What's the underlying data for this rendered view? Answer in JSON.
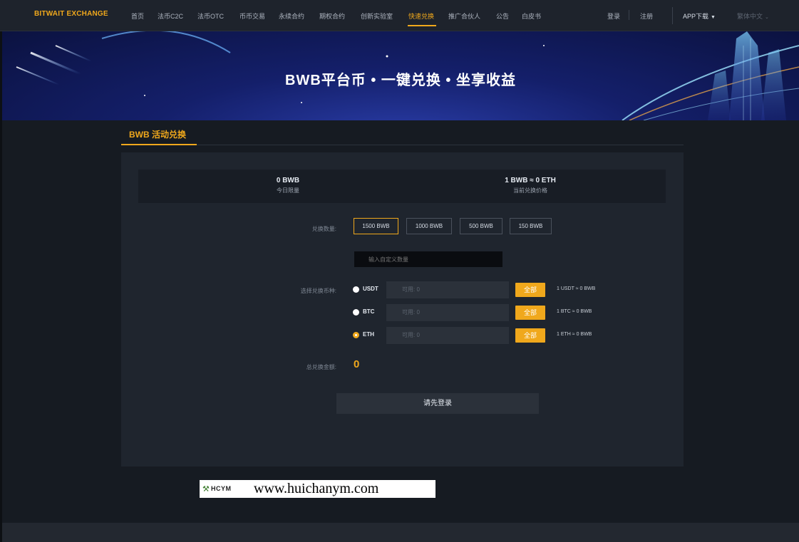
{
  "nav": {
    "logo": "BITWAIT EXCHANGE",
    "items": [
      "首页",
      "法币C2C",
      "法币OTC",
      "币币交易",
      "永续合约",
      "期权合约",
      "创新实验室",
      "快速兑换",
      "推广合伙人",
      "公告",
      "白皮书"
    ],
    "active": "快速兑换",
    "login": "登录",
    "register": "注册",
    "app_download": "APP下载",
    "language": "繁体中文"
  },
  "banner": {
    "title": "BWB平台币 • 一键兑换 • 坐享收益"
  },
  "tab": {
    "label": "BWB 活动兑换"
  },
  "stats": {
    "daily_limit_value": "0 BWB",
    "daily_limit_label": "今日限量",
    "price_value": "1 BWB ≈ 0 ETH",
    "price_label": "当前兑换价格"
  },
  "form": {
    "amount_label": "兑换数量:",
    "amount_options": [
      "1500 BWB",
      "1000 BWB",
      "500 BWB",
      "150 BWB"
    ],
    "selected_amount": "1500 BWB",
    "custom_placeholder": "输入自定义数量",
    "coin_label": "选择兑换币种:",
    "coins": [
      {
        "name": "USDT",
        "available": "可用: 0",
        "all_label": "全部",
        "rate": "1 USDT ≈ 0 BWB",
        "checked": false
      },
      {
        "name": "BTC",
        "available": "可用: 0",
        "all_label": "全部",
        "rate": "1 BTC ≈ 0 BWB",
        "checked": false
      },
      {
        "name": "ETH",
        "available": "可用: 0",
        "all_label": "全部",
        "rate": "1 ETH ≈ 0 BWB",
        "checked": true
      }
    ],
    "total_label": "总兑换金额:",
    "total_value": "0",
    "submit_label": "请先登录"
  },
  "watermark": {
    "brand": "HCYM",
    "url": "www.huichanym.com"
  },
  "colors": {
    "accent": "#f0a81c",
    "background": "#161b22",
    "panel": "#1f252e",
    "banner": "#141f6a"
  }
}
